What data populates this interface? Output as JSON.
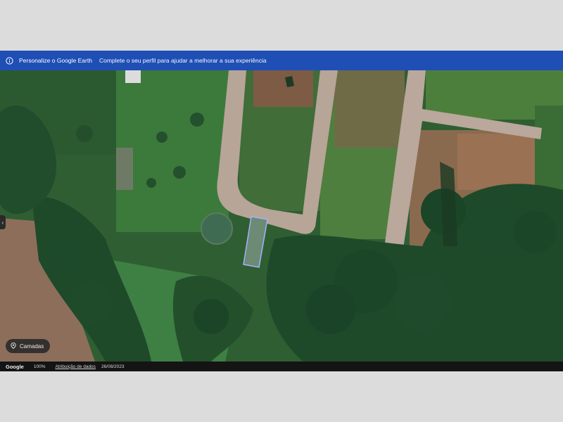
{
  "banner": {
    "icon": "info-icon",
    "title": "Personalize o Google Earth",
    "message": "Complete o seu perfil para ajudar a melhorar a sua experiência",
    "color": "#1f4fb5"
  },
  "controls": {
    "layers_label": "Camadas",
    "layers_icon": "map-pin-icon",
    "side_handle_icon": "chevron-left-icon"
  },
  "status": {
    "logo": "Google",
    "zoom": "100%",
    "attribution": "Atribuição de dados",
    "date": "26/08/2023"
  },
  "map": {
    "type": "satellite-imagery",
    "colors": {
      "forest": "#1f4a2c",
      "grass": "#3f7a3a",
      "dirt": "#8a6a4f",
      "road": "#b9a89b",
      "pond": "#3f6b52"
    }
  }
}
